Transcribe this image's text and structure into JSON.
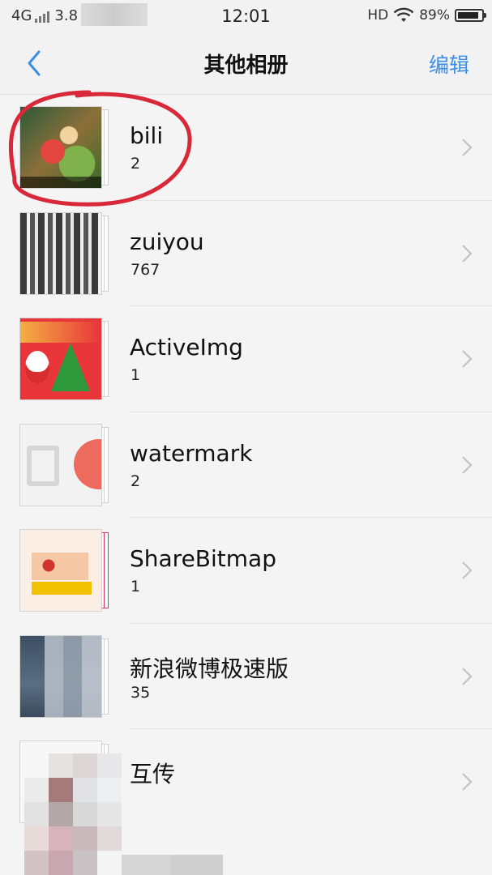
{
  "status_bar": {
    "network": "4G",
    "speed": "3.8",
    "time": "12:01",
    "hd": "HD",
    "battery_percent": "89%",
    "battery_level": 0.89
  },
  "nav": {
    "title": "其他相册",
    "edit_label": "编辑"
  },
  "albums": [
    {
      "name": "bili",
      "count": "2"
    },
    {
      "name": "zuiyou",
      "count": "767"
    },
    {
      "name": "ActiveImg",
      "count": "1"
    },
    {
      "name": "watermark",
      "count": "2"
    },
    {
      "name": "ShareBitmap",
      "count": "1"
    },
    {
      "name": "新浪微博极速版",
      "count": "35"
    },
    {
      "name": "互传",
      "count": ""
    }
  ],
  "colors": {
    "accent": "#3a8ee6",
    "annotation": "#d9283a"
  }
}
